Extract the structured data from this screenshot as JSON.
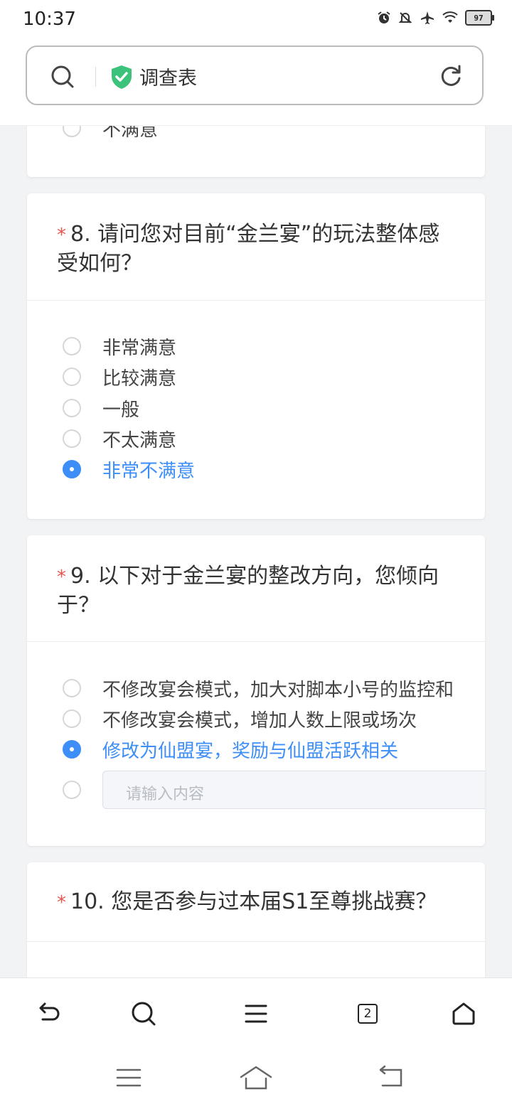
{
  "status_bar": {
    "time": "10:37",
    "battery": "97"
  },
  "address_bar": {
    "title": "调查表",
    "brand_color": "#3cc27a"
  },
  "accent_color": "#3e8ef7",
  "prev_question": {
    "last_option": "不满意"
  },
  "questions": [
    {
      "required_mark": "*",
      "number": "8.",
      "text": "请问您对目前“金兰宴”的玩法整体感受如何？",
      "options": [
        {
          "label": "非常满意",
          "selected": false
        },
        {
          "label": "比较满意",
          "selected": false
        },
        {
          "label": "一般",
          "selected": false
        },
        {
          "label": "不太满意",
          "selected": false
        },
        {
          "label": "非常不满意",
          "selected": true
        }
      ]
    },
    {
      "required_mark": "*",
      "number": "9.",
      "text": "以下对于金兰宴的整改方向，您倾向于？",
      "options": [
        {
          "label": "不修改宴会模式，加大对脚本小号的监控和",
          "selected": false
        },
        {
          "label": "不修改宴会模式，增加人数上限或场次",
          "selected": false
        },
        {
          "label": "修改为仙盟宴，奖励与仙盟活跃相关",
          "selected": true
        }
      ],
      "other_placeholder": "请输入内容"
    },
    {
      "required_mark": "*",
      "number": "10.",
      "text": "您是否参与过本届S1至尊挑战赛？"
    }
  ],
  "toolbar": [
    "back-icon",
    "search-icon",
    "menu-icon",
    "tabs-icon",
    "home-icon"
  ],
  "toolbar_tabs_count": "2",
  "navbar": [
    "recent-apps-icon",
    "home-icon",
    "back-icon"
  ]
}
